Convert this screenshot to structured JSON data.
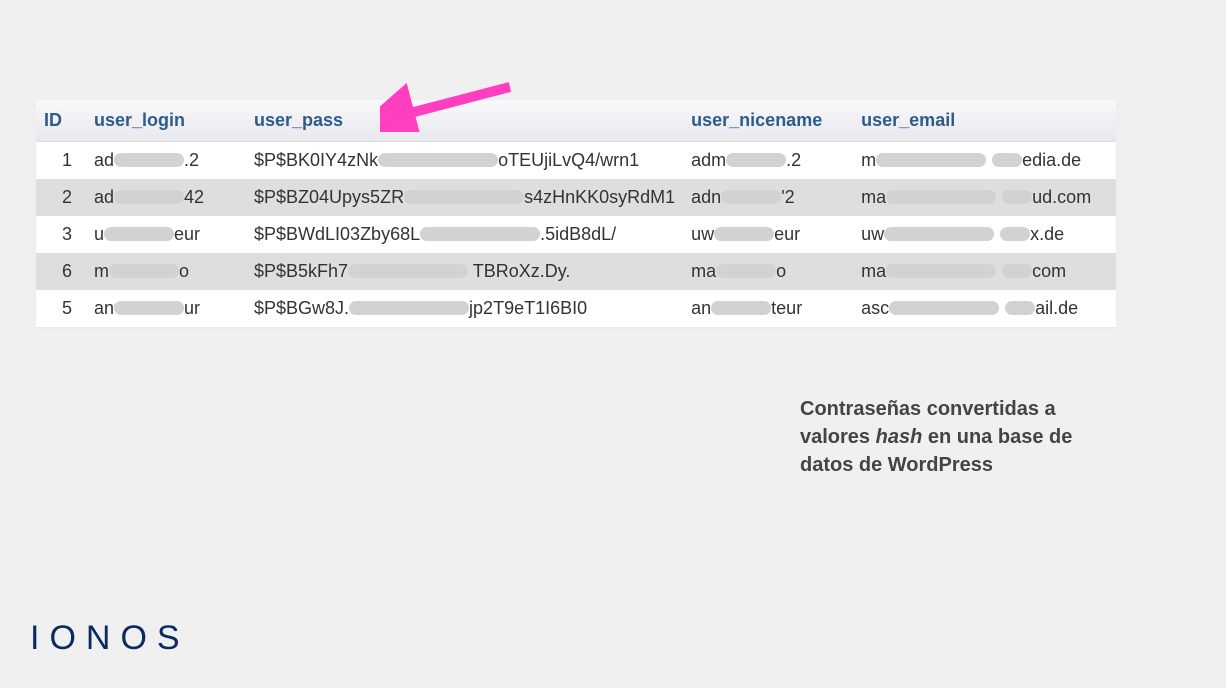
{
  "table": {
    "headers": {
      "id": "ID",
      "user_login": "user_login",
      "user_pass": "user_pass",
      "user_nicename": "user_nicename",
      "user_email": "user_email"
    },
    "rows": [
      {
        "id": "1",
        "login_pre": "ad",
        "login_suf": ".2",
        "pass_pre": "$P$BK0IY4zNk",
        "pass_suf": "oTEUjiLvQ4/wrn1",
        "nice_pre": "adm",
        "nice_suf": ".2",
        "email_pre": "m",
        "email_suf": "edia.de"
      },
      {
        "id": "2",
        "login_pre": "ad",
        "login_suf": "42",
        "pass_pre": "$P$BZ04Upys5ZR",
        "pass_suf": "s4zHnKK0syRdM1",
        "nice_pre": "adn",
        "nice_suf": "'2",
        "email_pre": "ma",
        "email_suf": "ud.com"
      },
      {
        "id": "3",
        "login_pre": "u",
        "login_suf": "eur",
        "pass_pre": "$P$BWdLI03Zby68L",
        "pass_suf": ".5idB8dL/",
        "nice_pre": "uw",
        "nice_suf": "eur",
        "email_pre": "uw",
        "email_suf": "x.de"
      },
      {
        "id": "6",
        "login_pre": "m",
        "login_suf": "o",
        "pass_pre": "$P$B5kFh7",
        "pass_suf": " TBRoXz.Dy.",
        "nice_pre": "ma",
        "nice_suf": "o",
        "email_pre": "ma",
        "email_suf": "com"
      },
      {
        "id": "5",
        "login_pre": "an",
        "login_suf": "ur",
        "pass_pre": "$P$BGw8J.",
        "pass_suf": "jp2T9eT1I6BI0",
        "nice_pre": "an",
        "nice_suf": "teur",
        "email_pre": "asc",
        "email_suf": "ail.de"
      }
    ]
  },
  "caption": {
    "line1": "Contraseñas convertidas a valores ",
    "hash": "hash",
    "line2": " en una base de datos de WordPress"
  },
  "logo": "IONOS",
  "arrow_color": "#ff3fbf"
}
